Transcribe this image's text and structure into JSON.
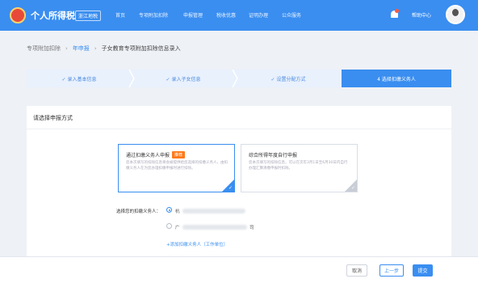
{
  "header": {
    "brand": "个人所得税",
    "region": "浙江地税",
    "nav": [
      "首页",
      "专项附加扣除",
      "申报管理",
      "税收优惠",
      "证明办理",
      "公众服务"
    ],
    "help": "帮助中心"
  },
  "breadcrumb": {
    "root": "专项附加扣除",
    "year": "年申报",
    "current": "子女教育专项附加扣除信息录入"
  },
  "steps": [
    "✓ 录入基本信息",
    "✓ 录入子女信息",
    "✓ 设置分配方式",
    "4 选择扣缴义务人"
  ],
  "section_title": "请选择申报方式",
  "options": [
    {
      "title": "通过扣缴义务人申报",
      "badge": "推荐",
      "desc": "您本次填写的扣除信息将会被提供给您选择的扣缴义务人，由扣缴义务人在为您办理扣缴申报时进行扣除。",
      "selected": true
    },
    {
      "title": "综合所得年度自行申报",
      "desc": "您本次填写的扣除信息，可以在次年3月1日至6月30日内自行办理汇算清缴申报时扣除。",
      "selected": false
    }
  ],
  "agent": {
    "label": "选择您的扣缴义务人：",
    "option1_prefix": "杭",
    "option2_prefix": "广",
    "option2_suffix": "司",
    "add": "+添加扣缴义务人（工作单位）"
  },
  "footer": {
    "cancel": "取消",
    "prev": "上一步",
    "submit": "提交"
  },
  "colors": {
    "primary": "#3a8ef0",
    "badge": "#ff7a1a"
  }
}
